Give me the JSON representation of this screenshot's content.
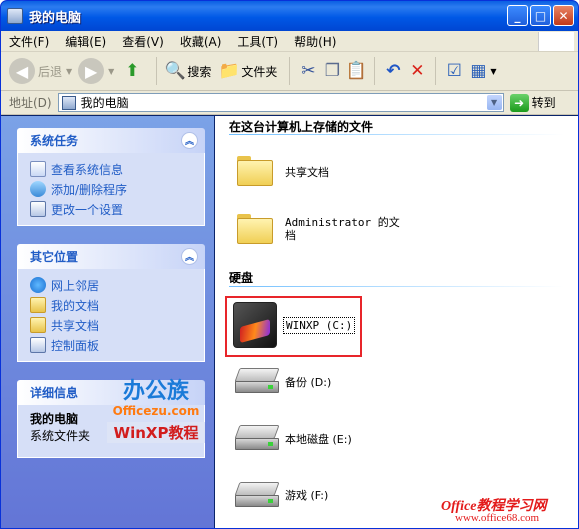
{
  "window": {
    "title": "我的电脑"
  },
  "menu": [
    "文件(F)",
    "编辑(E)",
    "查看(V)",
    "收藏(A)",
    "工具(T)",
    "帮助(H)"
  ],
  "toolbar": {
    "back": "后退",
    "search": "搜索",
    "folders": "文件夹"
  },
  "address": {
    "label": "地址(D)",
    "value": "我的电脑",
    "go": "转到"
  },
  "left": {
    "system_tasks": {
      "title": "系统任务",
      "links": [
        "查看系统信息",
        "添加/删除程序",
        "更改一个设置"
      ]
    },
    "other_places": {
      "title": "其它位置",
      "links": [
        "网上邻居",
        "我的文档",
        "共享文档",
        "控制面板"
      ]
    },
    "details": {
      "title": "详细信息",
      "name": "我的电脑",
      "type": "系统文件夹"
    },
    "logo": {
      "text1": "办公族",
      "text2": "Officezu.com",
      "text3": "WinXP教程"
    }
  },
  "main": {
    "stored_title": "在这台计算机上存储的文件",
    "folders": [
      "共享文档",
      "Administrator 的文档"
    ],
    "disks_title": "硬盘",
    "drives": [
      "WINXP (C:)",
      "备份 (D:)",
      "本地磁盘 (E:)",
      "游戏 (F:)"
    ]
  },
  "watermark": {
    "line1": "Office教程学习网",
    "line2": "www.office68.com"
  },
  "colors": {
    "titlebar": "#0058e6",
    "task_pane": "#7ba2e7",
    "link": "#215dc6",
    "highlight": "#e8252a"
  }
}
